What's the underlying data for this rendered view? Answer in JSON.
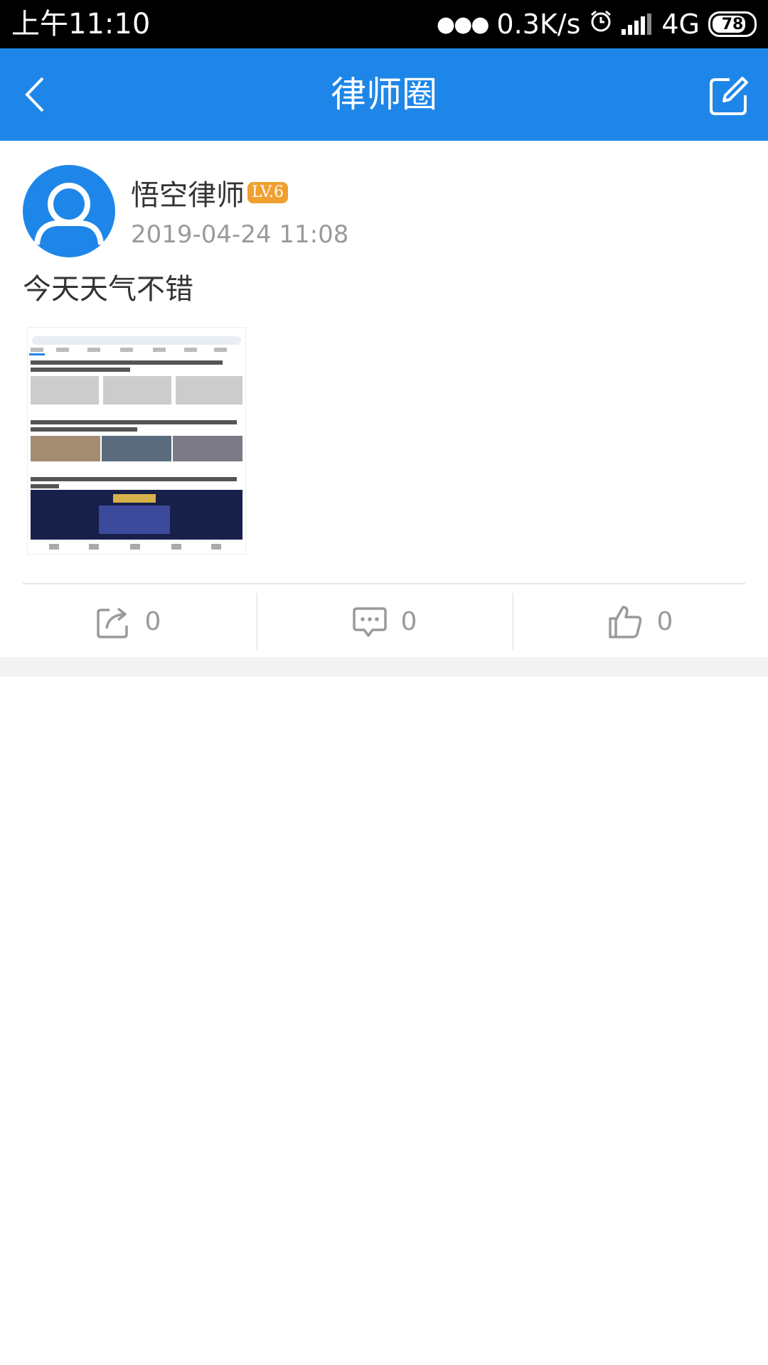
{
  "status_bar": {
    "time": "上午11:10",
    "speed": "0.3K/s",
    "network": "4G",
    "battery": "78"
  },
  "app_bar": {
    "title": "律师圈"
  },
  "post": {
    "author": "悟空律师",
    "level": "LV.6",
    "time": "2019-04-24 11:08",
    "text": "今天天气不错",
    "actions": {
      "share_count": "0",
      "comment_count": "0",
      "like_count": "0"
    }
  },
  "colors": {
    "primary": "#1e86e8",
    "badge": "#f0a030"
  }
}
